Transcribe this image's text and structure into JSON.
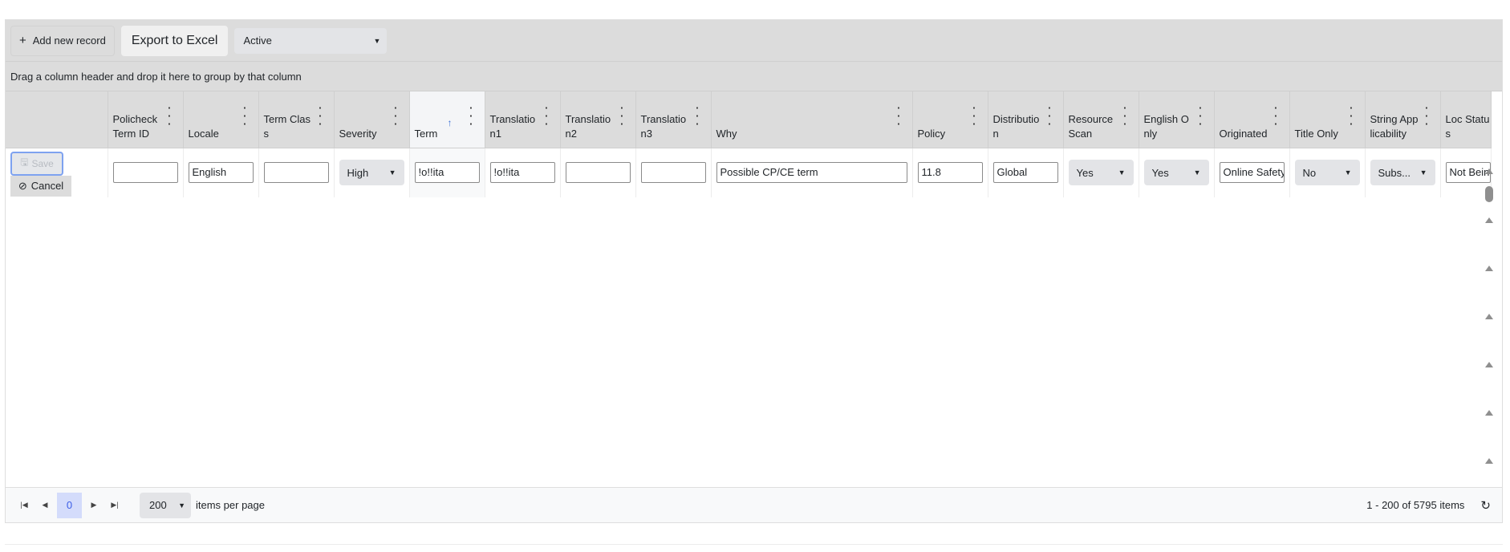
{
  "toolbar": {
    "add_label": "Add new record",
    "export_label": "Export to Excel",
    "status_filter": "Active"
  },
  "grouping_hint": "Drag a column header and drop it here to group by that column",
  "columns": [
    "Policheck Term ID",
    "Locale",
    "Term Class",
    "Severity",
    "Term",
    "Translation1",
    "Translation2",
    "Translation3",
    "Why",
    "Policy",
    "Distribution",
    "Resource Scan",
    "English Only",
    "Originated",
    "Title Only",
    "String Applicability",
    "Loc Status"
  ],
  "sorted_column": "Term",
  "sort_direction": "ascending",
  "edit_row": {
    "save_label": "Save",
    "cancel_label": "Cancel",
    "policheck_term_id": "",
    "locale": "English",
    "term_class": "",
    "severity": "High",
    "term": "!o!!ita",
    "translation1": "!o!!ita",
    "translation2": "",
    "translation3": "",
    "why": "Possible CP/CE term",
    "policy": "11.8",
    "distribution": "Global",
    "resource_scan": "Yes",
    "english_only": "Yes",
    "originated": "Online Safety",
    "title_only": "No",
    "string_applicability": "Subs...",
    "loc_status": "Not Being"
  },
  "pager": {
    "current_page": "0",
    "page_size": "200",
    "items_per_page_label": "items per page",
    "info": "1 - 200 of 5795 items"
  },
  "accent_color": "#3b5de7"
}
